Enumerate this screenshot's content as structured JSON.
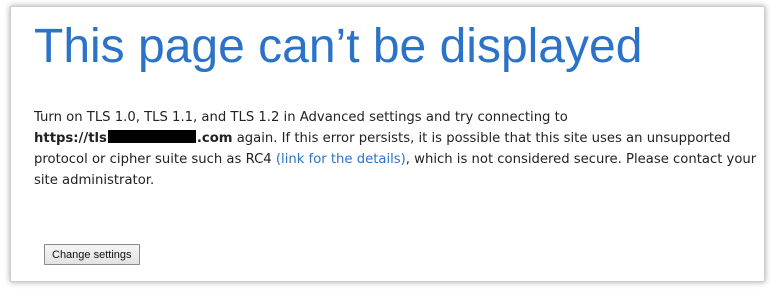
{
  "title": "This page can’t be displayed",
  "message": {
    "line_start": "Turn on TLS 1.0, TLS 1.1, and TLS 1.2 in Advanced settings and try connecting to",
    "host_prefix": "https://tls",
    "host_suffix": ".com",
    "after_host": " again. If this error persists, it is possible that this site uses an unsupported protocol or cipher suite such as RC4 ",
    "link_text": "(link for the details)",
    "after_link": ", which is not considered secure. Please contact your site administrator."
  },
  "buttons": {
    "change_settings": "Change settings"
  },
  "colors": {
    "title": "#2b73c9",
    "link": "#2b73c9",
    "text": "#222222"
  }
}
